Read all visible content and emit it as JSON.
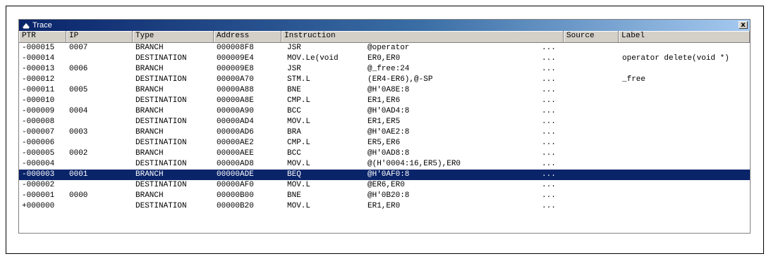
{
  "window": {
    "title": "Trace",
    "close_label": "x"
  },
  "columns": [
    "PTR",
    "IP",
    "Type",
    "Address",
    "Instruction",
    "Source",
    "Label"
  ],
  "rows": [
    {
      "ptr": "-000015",
      "ip": "0007",
      "type": "BRANCH",
      "address": "000008F8",
      "mnemonic": "JSR",
      "operand": "@operator",
      "source": "...",
      "label": ""
    },
    {
      "ptr": "-000014",
      "ip": "",
      "type": "DESTINATION",
      "address": "000009E4",
      "mnemonic": "MOV.Le(void",
      "operand": "ER0,ER0",
      "source": "...",
      "label": "operator delete(void *)"
    },
    {
      "ptr": "-000013",
      "ip": "0006",
      "type": "BRANCH",
      "address": "000009E8",
      "mnemonic": "JSR",
      "operand": "@_free:24",
      "source": "...",
      "label": ""
    },
    {
      "ptr": "-000012",
      "ip": "",
      "type": "DESTINATION",
      "address": "00000A70",
      "mnemonic": "STM.L",
      "operand": "(ER4-ER6),@-SP",
      "source": "...",
      "label": "_free"
    },
    {
      "ptr": "-000011",
      "ip": "0005",
      "type": "BRANCH",
      "address": "00000A88",
      "mnemonic": "BNE",
      "operand": "@H'0A8E:8",
      "source": "...",
      "label": ""
    },
    {
      "ptr": "-000010",
      "ip": "",
      "type": "DESTINATION",
      "address": "00000A8E",
      "mnemonic": "CMP.L",
      "operand": "ER1,ER6",
      "source": "...",
      "label": ""
    },
    {
      "ptr": "-000009",
      "ip": "0004",
      "type": "BRANCH",
      "address": "00000A90",
      "mnemonic": "BCC",
      "operand": "@H'0AD4:8",
      "source": "...",
      "label": ""
    },
    {
      "ptr": "-000008",
      "ip": "",
      "type": "DESTINATION",
      "address": "00000AD4",
      "mnemonic": "MOV.L",
      "operand": "ER1,ER5",
      "source": "...",
      "label": ""
    },
    {
      "ptr": "-000007",
      "ip": "0003",
      "type": "BRANCH",
      "address": "00000AD6",
      "mnemonic": "BRA",
      "operand": "@H'0AE2:8",
      "source": "...",
      "label": ""
    },
    {
      "ptr": "-000006",
      "ip": "",
      "type": "DESTINATION",
      "address": "00000AE2",
      "mnemonic": "CMP.L",
      "operand": "ER5,ER6",
      "source": "...",
      "label": ""
    },
    {
      "ptr": "-000005",
      "ip": "0002",
      "type": "BRANCH",
      "address": "00000AEE",
      "mnemonic": "BCC",
      "operand": "@H'0AD8:8",
      "source": "...",
      "label": ""
    },
    {
      "ptr": "-000004",
      "ip": "",
      "type": "DESTINATION",
      "address": "00000AD8",
      "mnemonic": "MOV.L",
      "operand": "@(H'0004:16,ER5),ER0",
      "source": "...",
      "label": ""
    },
    {
      "ptr": "-000003",
      "ip": "0001",
      "type": "BRANCH",
      "address": "00000ADE",
      "mnemonic": "BEQ",
      "operand": "@H'0AF0:8",
      "source": "...",
      "label": "",
      "selected": true
    },
    {
      "ptr": "-000002",
      "ip": "",
      "type": "DESTINATION",
      "address": "00000AF0",
      "mnemonic": "MOV.L",
      "operand": "@ER6,ER0",
      "source": "...",
      "label": ""
    },
    {
      "ptr": "-000001",
      "ip": "0000",
      "type": "BRANCH",
      "address": "00000B00",
      "mnemonic": "BNE",
      "operand": "@H'0B20:8",
      "source": "...",
      "label": ""
    },
    {
      "ptr": "+000000",
      "ip": "",
      "type": "DESTINATION",
      "address": "00000B20",
      "mnemonic": "MOV.L",
      "operand": "ER1,ER0",
      "source": "...",
      "label": ""
    }
  ],
  "colors": {
    "selection": "#0a246a",
    "title_start": "#0a246a",
    "title_end": "#a6caf0"
  }
}
